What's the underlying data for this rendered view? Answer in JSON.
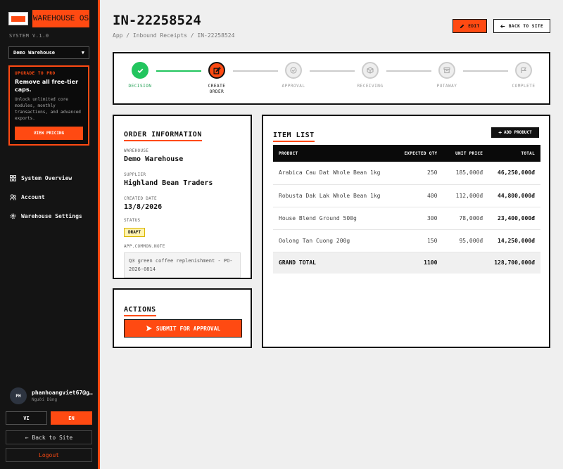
{
  "app": {
    "brand": "WAREHOUSE OS",
    "version": "SYSTEM V.1.0",
    "warehouse_select": "Demo Warehouse"
  },
  "promo": {
    "tag": "UPGRADE TO PRO",
    "headline": "Remove all free-tier caps.",
    "body": "Unlock unlimited core modules, monthly transactions, and advanced exports.",
    "button": "VIEW PRICING"
  },
  "nav": [
    {
      "label": "System Overview",
      "icon": "grid-icon"
    },
    {
      "label": "Account",
      "icon": "users-icon"
    },
    {
      "label": "Warehouse Settings",
      "icon": "gear-icon"
    }
  ],
  "user": {
    "initials": "PH",
    "name": "phanhoangviet67@g…",
    "role": "Người Dùng"
  },
  "lang": {
    "vi": "VI",
    "en": "EN"
  },
  "sidebar_buttons": {
    "back": "← Back to Site",
    "logout": "Logout"
  },
  "header": {
    "title": "IN-22258524",
    "breadcrumb": "App / Inbound Receipts / IN-22258524",
    "edit": "EDIT",
    "back": "BACK TO SITE"
  },
  "steps": [
    {
      "label": "DECISION",
      "state": "done"
    },
    {
      "label": "CREATE ORDER",
      "state": "current"
    },
    {
      "label": "APPROVAL",
      "state": "pending"
    },
    {
      "label": "RECEIVING",
      "state": "pending"
    },
    {
      "label": "PUTAWAY",
      "state": "pending"
    },
    {
      "label": "COMPLETE",
      "state": "pending"
    }
  ],
  "order_info": {
    "title": "ORDER INFORMATION",
    "warehouse_label": "WAREHOUSE",
    "warehouse": "Demo Warehouse",
    "supplier_label": "SUPPLIER",
    "supplier": "Highland Bean Traders",
    "created_label": "CREATED DATE",
    "created": "13/8/2026",
    "status_label": "STATUS",
    "status": "DRAFT",
    "note_label": "APP.COMMON.NOTE",
    "note": "Q3 green coffee replenishment - PO-2026-0814"
  },
  "actions": {
    "title": "ACTIONS",
    "submit": "SUBMIT FOR APPROVAL"
  },
  "items": {
    "title": "ITEM LIST",
    "add": "ADD PRODUCT",
    "headers": [
      "PRODUCT",
      "EXPECTED QTY",
      "UNIT PRICE",
      "TOTAL"
    ],
    "rows": [
      [
        "Arabica Cau Dat Whole Bean 1kg",
        "250",
        "185,000đ",
        "46,250,000đ"
      ],
      [
        "Robusta Dak Lak Whole Bean 1kg",
        "400",
        "112,000đ",
        "44,800,000đ"
      ],
      [
        "House Blend Ground 500g",
        "300",
        "78,000đ",
        "23,400,000đ"
      ],
      [
        "Oolong Tan Cuong 200g",
        "150",
        "95,000đ",
        "14,250,000đ"
      ]
    ],
    "grand_total_label": "GRAND TOTAL",
    "grand_total_qty": "1100",
    "grand_total": "128,700,000đ"
  },
  "colors": {
    "accent": "#ff4a12",
    "done": "#22c55e",
    "sidebar": "#141414"
  }
}
